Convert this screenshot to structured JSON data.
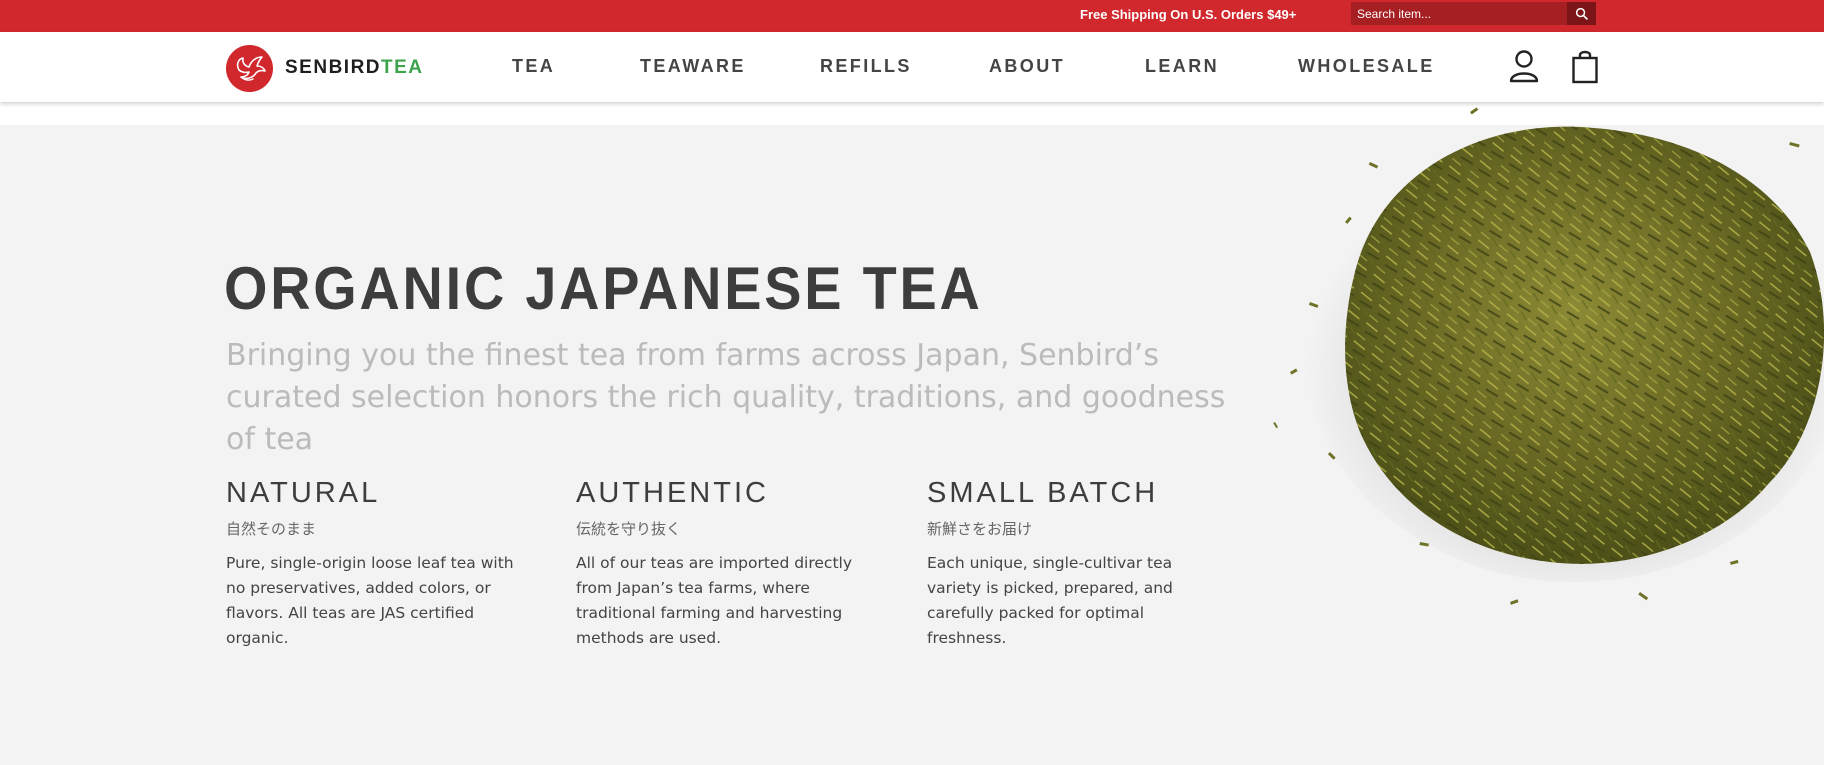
{
  "promo": {
    "text": "Free Shipping On U.S. Orders $49+",
    "search_placeholder": "Search item..."
  },
  "header": {
    "logo": {
      "brand_part1": "SENBIRD",
      "brand_part2": "TEA"
    },
    "nav": [
      {
        "label": "TEA"
      },
      {
        "label": "TEAWARE"
      },
      {
        "label": "REFILLS"
      },
      {
        "label": "ABOUT"
      },
      {
        "label": "LEARN"
      },
      {
        "label": "WHOLESALE"
      }
    ],
    "icons": [
      "account-icon",
      "shopping-bag-icon"
    ]
  },
  "hero": {
    "title": "ORGANIC JAPANESE TEA",
    "subtitle": "Bringing you the finest tea from farms across Japan, Senbird’s curated selection honors the rich quality, traditions, and goodness of tea",
    "features": [
      {
        "title": "NATURAL",
        "japanese": "自然そのまま",
        "body": "Pure, single-origin loose leaf tea with no preservatives, added colors, or flavors. All teas are JAS certified organic."
      },
      {
        "title": "AUTHENTIC",
        "japanese": "伝統を守り抜く",
        "body": "All of our teas are imported directly from Japan’s tea farms, where traditional farming and harvesting methods are used."
      },
      {
        "title": "SMALL BATCH",
        "japanese": "新鮮さをお届け",
        "body": "Each unique, single-cultivar tea variety is picked, prepared, and carefully packed for optimal freshness."
      }
    ]
  },
  "colors": {
    "brand_red": "#d0282d",
    "brand_green": "#3fa34d",
    "hero_background": "#f3f3f3",
    "title_text": "#3d3d3d"
  }
}
